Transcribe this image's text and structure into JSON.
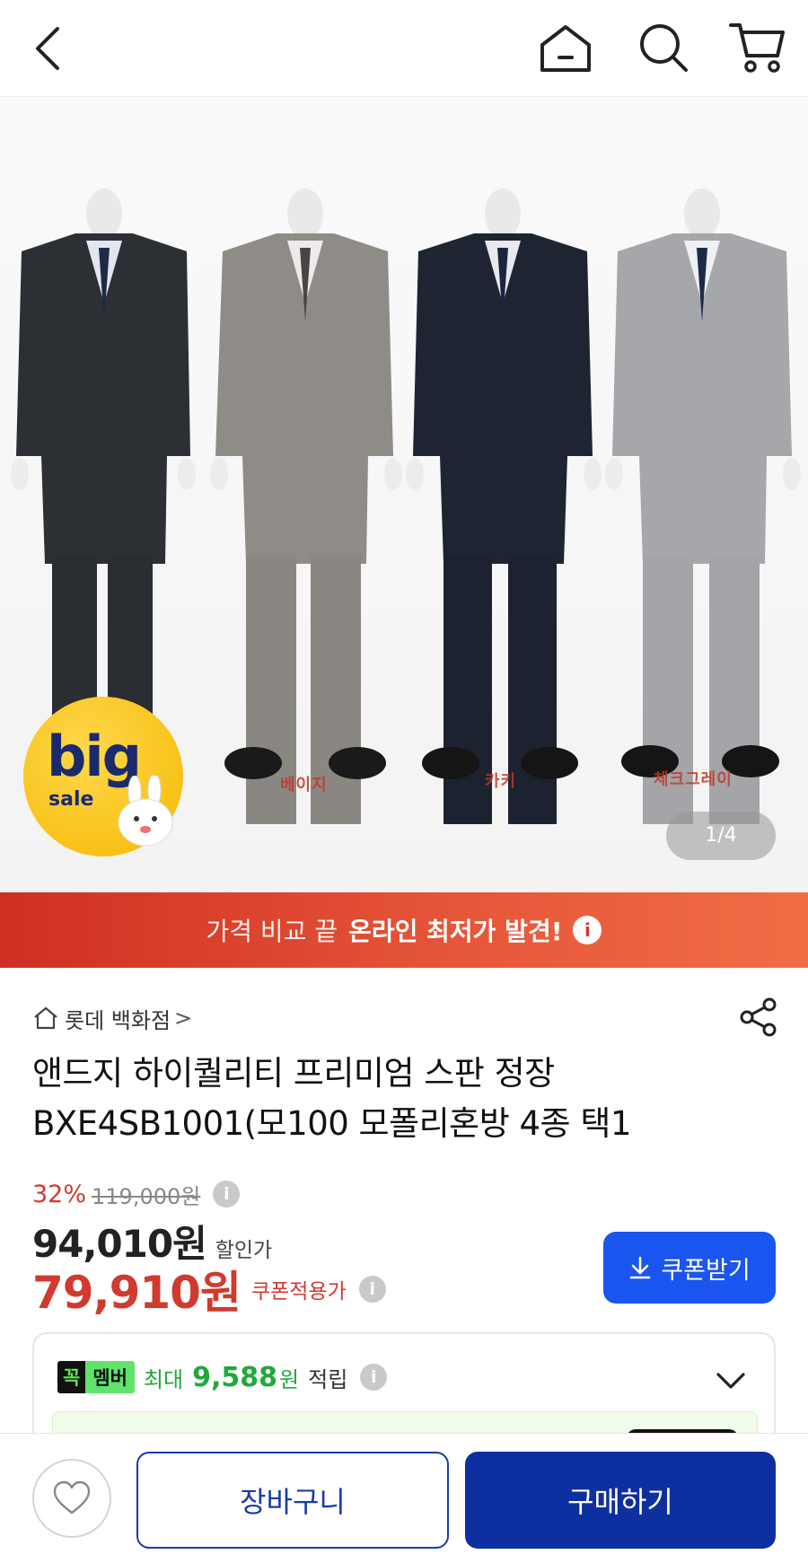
{
  "nav": {
    "icons": [
      "back-icon",
      "home-icon",
      "search-icon",
      "cart-icon"
    ]
  },
  "hero": {
    "color_labels": [
      "베이지",
      "카키",
      "체크그레이"
    ],
    "badge_big": "big",
    "badge_sale": "sale",
    "pager": "1/4"
  },
  "banner": {
    "normal_text": "가격 비교 끝",
    "strong_text": "온라인 최저가 발견!",
    "info_glyph": "i"
  },
  "product": {
    "store": "롯데 백화점",
    "store_chevron": ">",
    "title_line1": "앤드지 하이퀄리티 프리미엄 스판 정장",
    "title_line2": "BXE4SB1001(모100 모폴리혼방 4종 택1",
    "discount_pct": "32%",
    "original_price": "119,000원",
    "sale_price": "94,010원",
    "sale_label": "할인가",
    "coupon_price": "79,910원",
    "coupon_label": "쿠폰적용가",
    "coupon_button": "쿠폰받기",
    "info_glyph": "i"
  },
  "member": {
    "kkok": "꼭",
    "badge": "멤버",
    "max_label": "최대",
    "amount": "9,588",
    "won": "원",
    "earn": "적립",
    "info_glyph": "i"
  },
  "bottom": {
    "cart_label": "장바구니",
    "buy_label": "구매하기"
  },
  "colors": {
    "banner_red": "#cf2f23",
    "coupon_red": "#d03a2f",
    "primary_blue": "#1a55f0",
    "buy_navy": "#0e2fa0",
    "member_green": "#21a83a"
  }
}
